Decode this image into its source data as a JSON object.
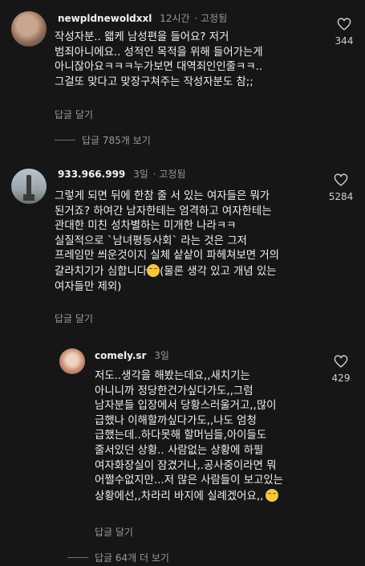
{
  "comments": [
    {
      "username": "newpldnewoldxxl",
      "time": "12시간",
      "pinned": "· 고정됨",
      "text": "작성자분.. 왧케 남성편을 들어요? 저거\n범죄아니에요.. 성적인 목적을 위해 들어가는게\n아니잖아요ㅋㅋㅋ누가보면 대역죄인인줄ㅋㅋ..\n그걸또 맞다고 맞장구쳐주는 작성자분도 참;;",
      "reply_label": "답글 달기",
      "view_replies": "답글 785개 보기",
      "likes": "344"
    },
    {
      "username": "933.966.999",
      "time": "3일",
      "pinned": "· 고정됨",
      "text_lines": [
        "그렇게 되면 뒤에 한참 줄 서 있는 여자들은 뭐가",
        "된거죠? 하여간 남자한테는 엄격하고 여자한테는",
        "관대한 미친 성차별하는 미개한 나라ㅋㅋ",
        "실질적으로 `남녀평등사회` 라는 것은 그저",
        "프레임만 씌운것이지 실체 샅샅이 파헤쳐보면 거의",
        "갈라치기가 심합니다",
        "(물론 생각 있고 개념 있는",
        "여자들만 제외)"
      ],
      "reply_label": "답글 달기",
      "likes": "5284"
    },
    {
      "username": "comely.sr",
      "time": "3일",
      "text_lines": [
        "저도..생각을 해봤는데요,,새치기는",
        "아니니까 정당한건가싶다가도,,그럼",
        "남자분들 입장에서 당황스러울거고,,많이",
        "급했나 이해할까싶다가도,,나도 엄청",
        "급했는데..하다못해 할머님들,아이들도",
        "줄서있던 상황.. 사람없는 상황에 하필",
        "여자화장실이 잠겼거나,.공사중이라면 뭐",
        "어쩔수없지만...저 많은 사람들이 보고있는",
        "상황에선,,차라리 바지에 실례겠어요,,"
      ],
      "reply_label": "답글 달기",
      "view_replies": "답글 64개 더 보기",
      "likes": "429"
    }
  ]
}
